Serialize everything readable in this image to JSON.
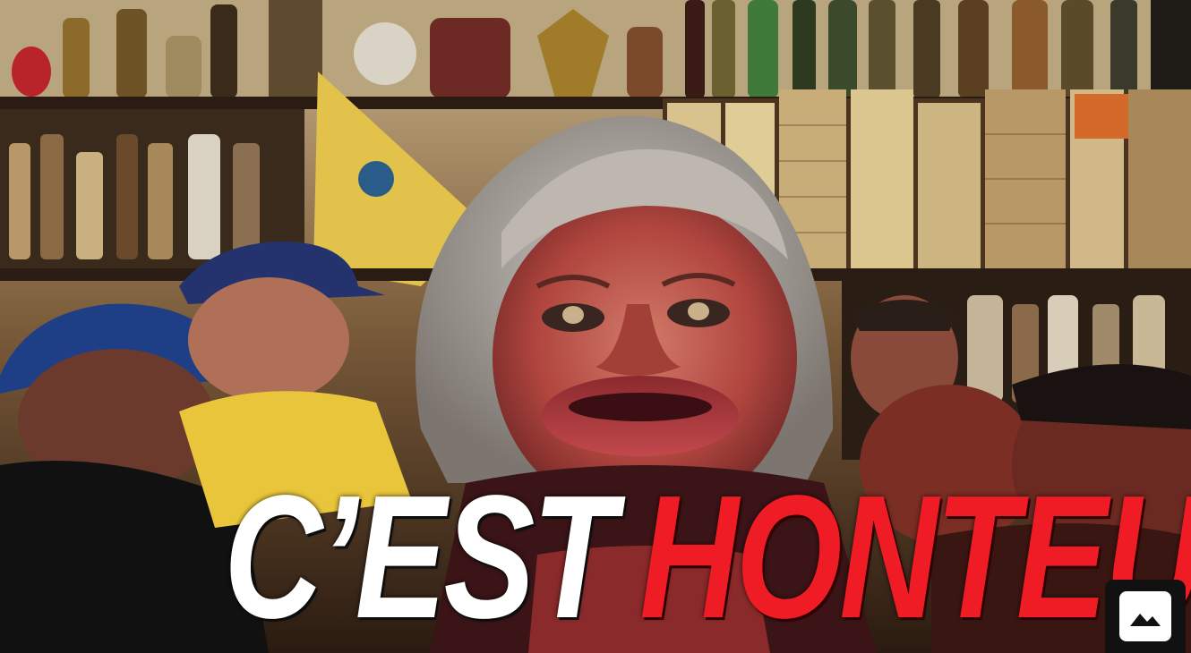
{
  "caption": {
    "word_1": "C’EST",
    "word_2": "HONTEUX"
  },
  "colors": {
    "caption_primary": "#ffffff",
    "caption_accent": "#ef1b25"
  },
  "controls": {
    "media_button_icon": "image-icon"
  }
}
